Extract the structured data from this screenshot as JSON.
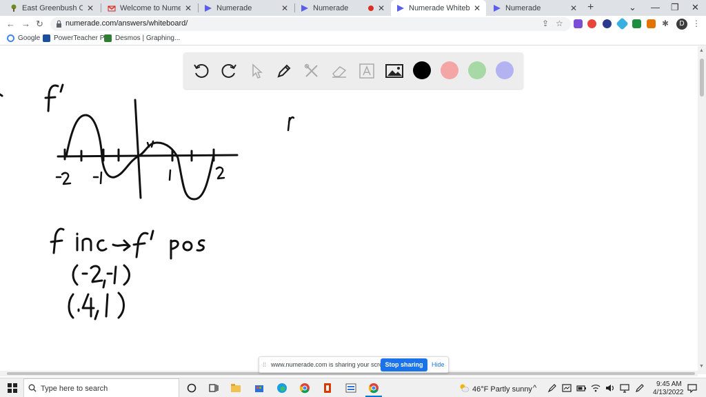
{
  "browser": {
    "tabs": [
      {
        "title": "East Greenbush CSD |",
        "active": false
      },
      {
        "title": "Welcome to Numerade! - f",
        "active": false
      },
      {
        "title": "Numerade",
        "active": false
      },
      {
        "title": "Numerade",
        "active": false
      },
      {
        "title": "Numerade Whiteboard",
        "active": true
      },
      {
        "title": "Numerade",
        "active": false
      }
    ],
    "url": "numerade.com/answers/whiteboard/",
    "profile_initial": "D",
    "bookmarks": [
      {
        "label": "Google",
        "icon": "google-icon"
      },
      {
        "label": "PowerTeacher Pro",
        "icon": "sis-icon"
      },
      {
        "label": "Desmos | Graphing...",
        "icon": "desmos-icon"
      }
    ]
  },
  "whiteboard": {
    "tools": [
      "undo-icon",
      "redo-icon",
      "pointer-icon",
      "pen-icon",
      "tools-icon",
      "eraser-icon",
      "text-icon",
      "image-icon"
    ],
    "colors": [
      "#000000",
      "#f4a6a6",
      "#a6d9a6",
      "#b3b3f2"
    ],
    "selected_color": "#000000",
    "handwriting": {
      "graph_title": "f'",
      "x_ticks": [
        "-2",
        "-1",
        "1",
        "2"
      ],
      "statement": "f inc → f' pos",
      "intervals": [
        "(-2,-1)",
        "(.4,1)"
      ],
      "marginal_mark": "f"
    }
  },
  "share_bar": {
    "message": "www.numerade.com is sharing your screen.",
    "stop_label": "Stop sharing",
    "hide_label": "Hide"
  },
  "taskbar": {
    "search_placeholder": "Type here to search",
    "weather": "46°F  Partly sunny",
    "time": "9:45 AM",
    "date": "4/13/2022"
  }
}
